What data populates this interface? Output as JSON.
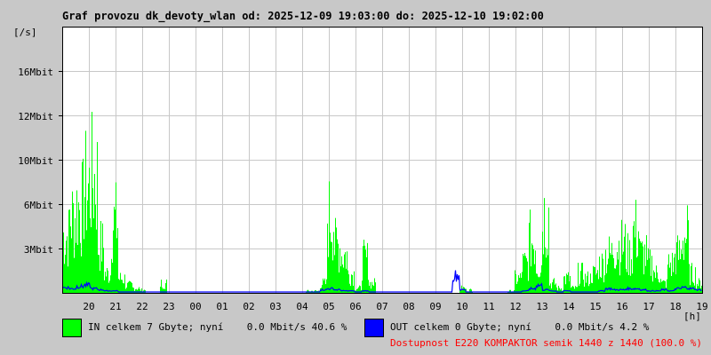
{
  "chart_data": {
    "type": "area",
    "title": "Graf provozu dk_devoty_wlan od: 2025-12-09 19:03:00 do: 2025-12-10 19:02:00",
    "ylabel": "[/s]",
    "xlabel": "[h]",
    "y_ticks": [
      "16Mbit",
      "12Mbit",
      "10Mbit",
      "6Mbit",
      "3Mbit"
    ],
    "ylim": [
      0,
      19.2
    ],
    "x_ticks": [
      "20",
      "21",
      "22",
      "23",
      "00",
      "01",
      "02",
      "03",
      "04",
      "05",
      "06",
      "07",
      "08",
      "09",
      "10",
      "11",
      "12",
      "13",
      "14",
      "15",
      "16",
      "17",
      "18",
      "19"
    ],
    "grid": true,
    "x_resolution": "15 min",
    "series": [
      {
        "name": "IN",
        "color": "#00ff00",
        "values": [
          6,
          8,
          9,
          11,
          12,
          5,
          2,
          7.5,
          1.5,
          0.8,
          0.5,
          0.3,
          0,
          0,
          1,
          0,
          0,
          0,
          0,
          0,
          0,
          0,
          0,
          0,
          0,
          0,
          0,
          0,
          0,
          0,
          0,
          0,
          0,
          0,
          0,
          0.2,
          0.2,
          1,
          8,
          5,
          4,
          2,
          0.5,
          3.5,
          1,
          0,
          0,
          0,
          0,
          0,
          0,
          0,
          0,
          0,
          0,
          0,
          0,
          0.5,
          0.3,
          0,
          0,
          0,
          0,
          0,
          0.2,
          1.5,
          3,
          5.5,
          3,
          8.2,
          1,
          0.5,
          1.5,
          0.5,
          2,
          1.5,
          2,
          3,
          4,
          5,
          5,
          4,
          6.5,
          4,
          3,
          2,
          1,
          3,
          4,
          6,
          2,
          1
        ]
      },
      {
        "name": "OUT",
        "color": "#0000ff",
        "values": [
          0.4,
          0.3,
          0.5,
          0.6,
          0.3,
          0.2,
          0.1,
          0.1,
          0,
          0,
          0,
          0,
          0,
          0,
          0,
          0,
          0,
          0,
          0,
          0,
          0,
          0,
          0,
          0,
          0,
          0,
          0,
          0,
          0,
          0,
          0,
          0,
          0,
          0,
          0,
          0,
          0,
          0.2,
          0.3,
          0.2,
          0.1,
          0.1,
          0,
          0.1,
          0,
          0,
          0,
          0,
          0,
          0,
          0,
          0,
          0,
          0,
          0,
          0,
          1.5,
          0.2,
          0,
          0,
          0,
          0,
          0,
          0,
          0,
          0,
          0.1,
          0.3,
          0.6,
          0.2,
          0.1,
          0,
          0.1,
          0,
          0,
          0,
          0,
          0.1,
          0.3,
          0.2,
          0.2,
          0.3,
          0.3,
          0.2,
          0.1,
          0.1,
          0.2,
          0.1,
          0.3,
          0.4,
          0.3,
          0.2
        ]
      }
    ]
  },
  "legend": {
    "in": "IN celkem 7 Gbyte; nyní    0.0 Mbit/s 40.6 %",
    "out": "OUT celkem 0 Gbyte; nyní    0.0 Mbit/s 4.2 %",
    "availability": "Dostupnost E220 KOMPAKTOR semik 1440 z 1440 (100.0 %)",
    "availability_color": "#ff0000"
  }
}
